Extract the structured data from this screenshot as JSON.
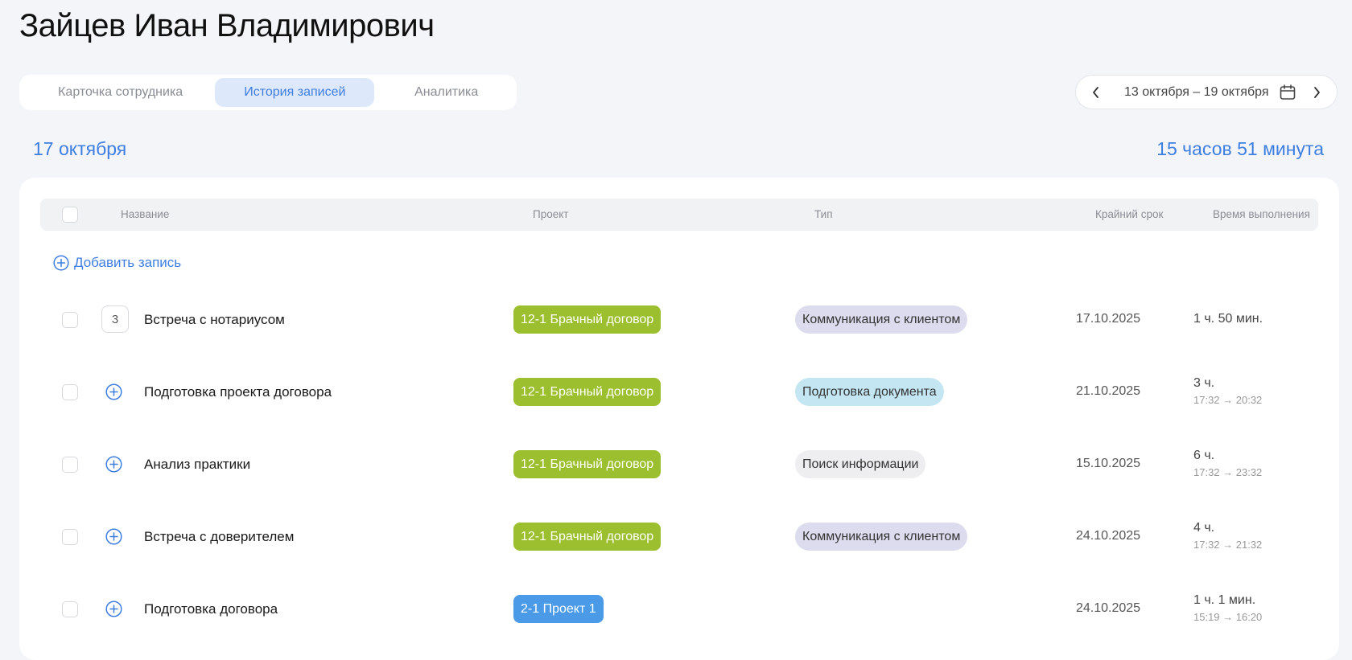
{
  "header": {
    "title": "Зайцев Иван Владимирович"
  },
  "tabs": [
    {
      "label": "Карточка сотрудника",
      "active": false
    },
    {
      "label": "История записей",
      "active": true
    },
    {
      "label": "Аналитика",
      "active": false
    }
  ],
  "week_nav": {
    "range": "13 октября – 19 октября"
  },
  "day": {
    "date": "17 октября",
    "total": "15 часов 51 минута"
  },
  "table": {
    "columns": {
      "name": "Название",
      "project": "Проект",
      "type": "Тип",
      "deadline": "Крайний срок",
      "duration": "Время выполнения"
    },
    "add_entry": "Добавить запись",
    "rows": [
      {
        "count": "3",
        "name": "Встреча с нотариусом",
        "project": "12-1 Брачный договор",
        "type": "Коммуникация с клиентом",
        "deadline": "17.10.2025",
        "duration": "1 ч. 50 мин.",
        "span": ""
      },
      {
        "count": "",
        "name": "Подготовка проекта договора",
        "project": "12-1 Брачный договор",
        "type": "Подготовка документа",
        "deadline": "21.10.2025",
        "duration": "3 ч.",
        "span": "17:32 → 20:32"
      },
      {
        "count": "",
        "name": "Анализ практики",
        "project": "12-1 Брачный договор",
        "type": "Поиск информации",
        "deadline": "15.10.2025",
        "duration": "6 ч.",
        "span": "17:32 → 23:32"
      },
      {
        "count": "",
        "name": "Встреча с доверителем",
        "project": "12-1 Брачный договор",
        "type": "Коммуникация с клиентом",
        "deadline": "24.10.2025",
        "duration": "4 ч.",
        "span": "17:32 → 21:32"
      },
      {
        "count": "",
        "name": "Подготовка договора",
        "project": "2-1 Проект 1",
        "type": "",
        "deadline": "24.10.2025",
        "duration": "1 ч. 1 мин.",
        "span": "15:19 → 16:20"
      }
    ]
  },
  "colors": {
    "accent": "#3d7ee0",
    "project_green": "#9cbf2f",
    "project_blue": "#4a9ae8",
    "type_communication": "#dcdcee",
    "type_document": "#c3e6f2",
    "type_search": "#eeeef0"
  }
}
